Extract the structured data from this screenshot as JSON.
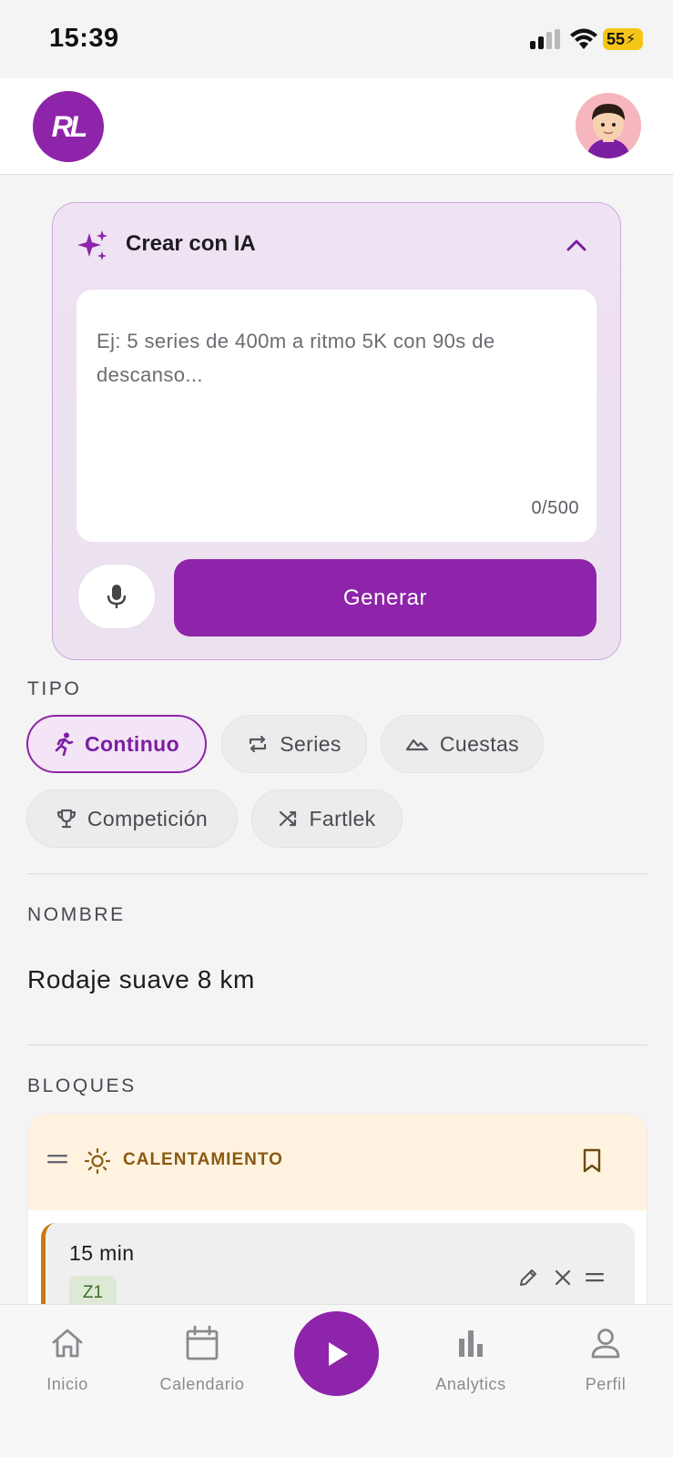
{
  "status_bar": {
    "time": "15:39",
    "battery": "55"
  },
  "header": {
    "logo_text": "RL"
  },
  "ai_card": {
    "title": "Crear con IA",
    "prompt_placeholder": "Ej: 5 series de 400m a ritmo 5K con 90s de descanso...",
    "prompt_value": "",
    "counter": "0/500",
    "generate_label": "Generar"
  },
  "tipo": {
    "label": "TIPO",
    "options": [
      {
        "label": "Continuo",
        "icon": "running-icon",
        "selected": true
      },
      {
        "label": "Series",
        "icon": "repeat-icon",
        "selected": false
      },
      {
        "label": "Cuestas",
        "icon": "mountain-icon",
        "selected": false
      },
      {
        "label": "Competición",
        "icon": "trophy-icon",
        "selected": false
      },
      {
        "label": "Fartlek",
        "icon": "shuffle-icon",
        "selected": false
      }
    ]
  },
  "nombre": {
    "label": "NOMBRE",
    "value": "Rodaje suave 8 km"
  },
  "bloques": {
    "label": "BLOQUES",
    "block": {
      "title": "CALENTAMIENTO",
      "step": {
        "duration": "15 min",
        "zone": "Z1"
      }
    }
  },
  "nav": {
    "items": [
      {
        "label": "Inicio",
        "icon": "home-icon"
      },
      {
        "label": "Calendario",
        "icon": "calendar-icon"
      },
      {
        "label": "",
        "icon": "play-icon"
      },
      {
        "label": "Analytics",
        "icon": "bar-chart-icon"
      },
      {
        "label": "Perfil",
        "icon": "person-icon"
      }
    ]
  },
  "colors": {
    "accent": "#8e24aa",
    "warmup": "#c77a12",
    "warmup_bg": "#fff3e0"
  }
}
